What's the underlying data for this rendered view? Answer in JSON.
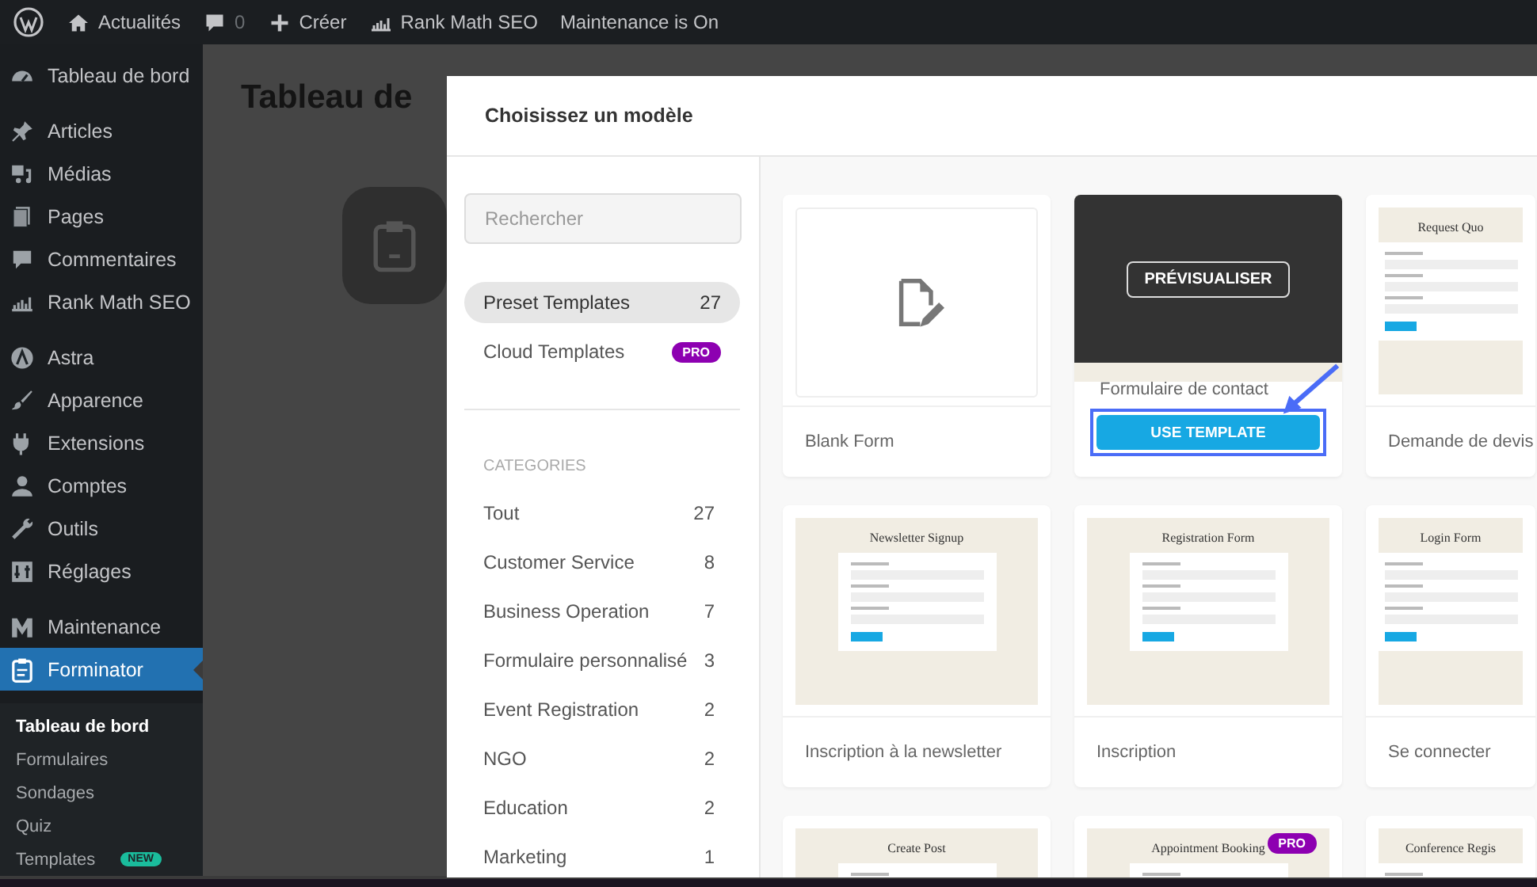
{
  "admin_bar": {
    "items": [
      {
        "kind": "logo"
      },
      {
        "kind": "home",
        "label": "Actualités"
      },
      {
        "kind": "comments",
        "label": "0"
      },
      {
        "kind": "new",
        "label": "Créer"
      },
      {
        "kind": "seo",
        "label": "Rank Math SEO"
      },
      {
        "kind": "text",
        "label": "Maintenance is On"
      }
    ]
  },
  "sidebar": {
    "groups": [
      [
        {
          "label": "Tableau de bord",
          "selected": false
        }
      ],
      [
        {
          "label": "Articles",
          "selected": false
        },
        {
          "label": "Médias",
          "selected": false
        },
        {
          "label": "Pages",
          "selected": false
        },
        {
          "label": "Commentaires",
          "selected": false
        },
        {
          "label": "Rank Math SEO",
          "selected": false
        }
      ],
      [
        {
          "label": "Astra",
          "selected": false
        },
        {
          "label": "Apparence",
          "selected": false
        },
        {
          "label": "Extensions",
          "selected": false
        },
        {
          "label": "Comptes",
          "selected": false
        },
        {
          "label": "Outils",
          "selected": false
        },
        {
          "label": "Réglages",
          "selected": false
        }
      ],
      [
        {
          "label": "Maintenance",
          "selected": false
        },
        {
          "label": "Forminator",
          "selected": true
        }
      ]
    ],
    "submenu": [
      {
        "label": "Tableau de bord",
        "selected": true
      },
      {
        "label": "Formulaires",
        "selected": false
      },
      {
        "label": "Sondages",
        "selected": false
      },
      {
        "label": "Quiz",
        "selected": false
      },
      {
        "label": "Templates",
        "selected": false,
        "badge": "NEW"
      }
    ]
  },
  "background": {
    "heading": "Tableau de"
  },
  "modal": {
    "title": "Choisissez un modèle",
    "search": {
      "placeholder": "Rechercher"
    },
    "sources": [
      {
        "label": "Preset Templates",
        "count": "27",
        "selected": true
      },
      {
        "label": "Cloud Templates",
        "badge": "PRO",
        "selected": false
      }
    ],
    "categories_heading": "CATEGORIES",
    "categories": [
      {
        "label": "Tout",
        "count": "27",
        "selected": false
      },
      {
        "label": "Customer Service",
        "count": "8",
        "selected": false
      },
      {
        "label": "Business Operation",
        "count": "7",
        "selected": false
      },
      {
        "label": "Formulaire personnalisé",
        "count": "3",
        "selected": false
      },
      {
        "label": "Event Registration",
        "count": "2",
        "selected": false
      },
      {
        "label": "NGO",
        "count": "2",
        "selected": false
      },
      {
        "label": "Education",
        "count": "2",
        "selected": false
      },
      {
        "label": "Marketing",
        "count": "1",
        "selected": false
      }
    ],
    "templates": [
      {
        "kind": "blank",
        "title": "Blank Form",
        "hovered": false
      },
      {
        "kind": "preview",
        "title": "Formulaire de contact",
        "hovered": true,
        "preview_button": "PRÉVISUALISER",
        "use_button": "USE TEMPLATE",
        "highlighted": true
      },
      {
        "kind": "preview",
        "title": "Demande de devis",
        "thumb_title": "Request Quo",
        "hovered": false
      },
      {
        "kind": "preview",
        "title": "Inscription à la newsletter",
        "thumb_title": "Newsletter Signup",
        "hovered": false
      },
      {
        "kind": "preview",
        "title": "Inscription",
        "thumb_title": "Registration Form",
        "hovered": false
      },
      {
        "kind": "preview",
        "title": "Se connecter",
        "thumb_title": "Login Form",
        "hovered": false
      },
      {
        "kind": "preview",
        "thumb_title": "Create Post",
        "hovered": false
      },
      {
        "kind": "preview",
        "thumb_title": "Appointment Booking",
        "badge": "PRO",
        "hovered": false
      },
      {
        "kind": "preview",
        "thumb_title": "Conference Regis",
        "hovered": false
      }
    ]
  }
}
